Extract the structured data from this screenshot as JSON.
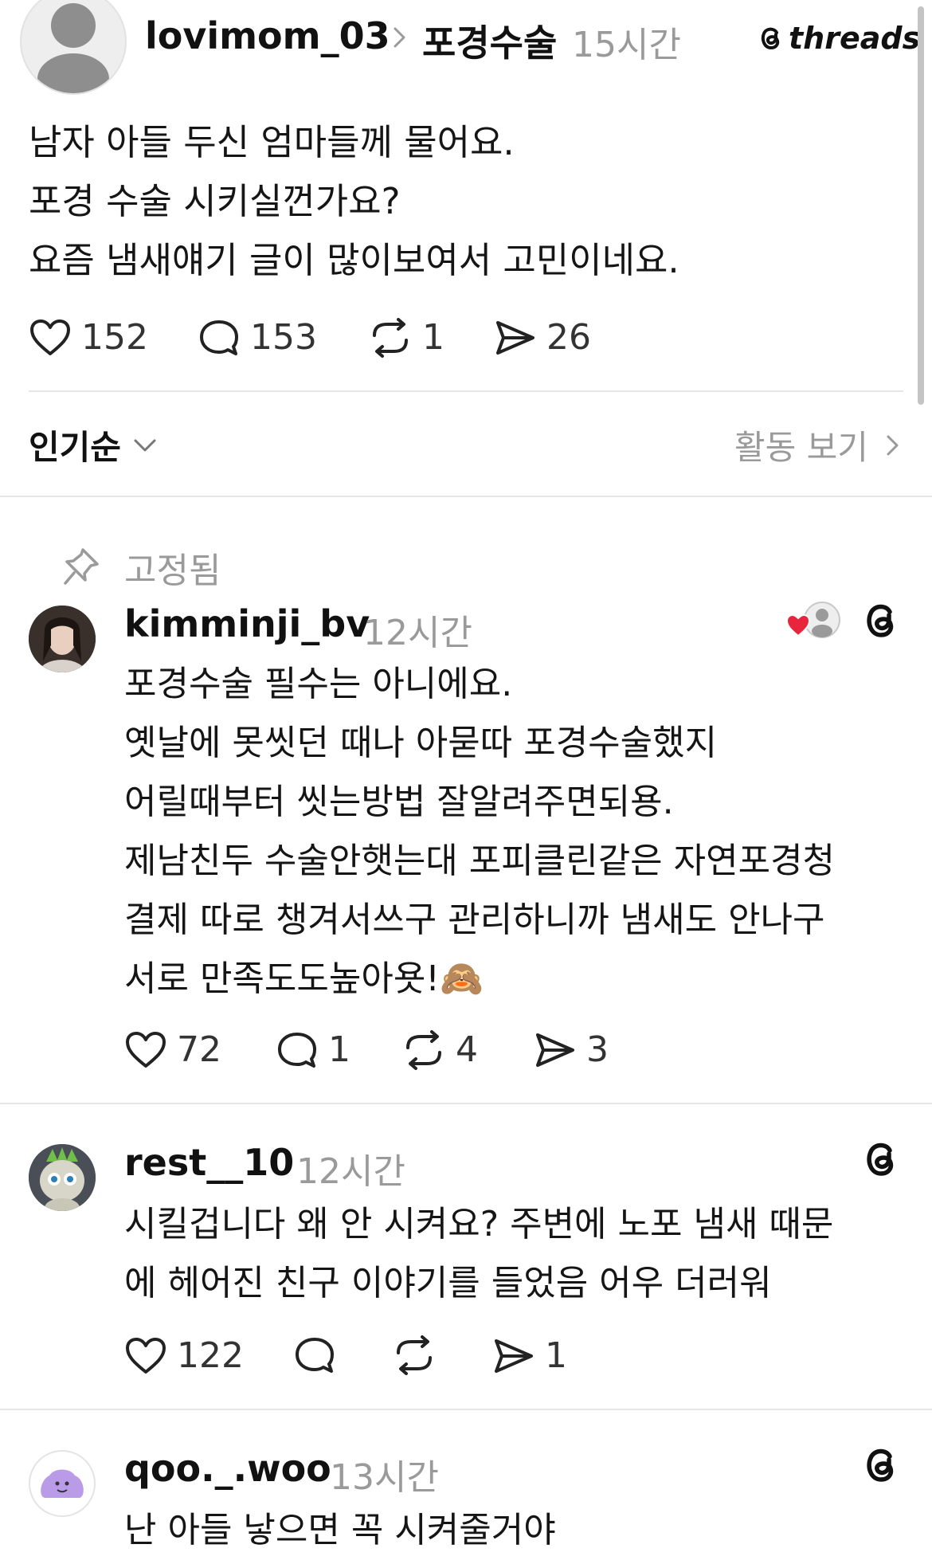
{
  "post": {
    "username": "lovimom_03",
    "topic": "포경수술",
    "time": "15시간",
    "brand": "threads",
    "text": "남자 아들 두신 엄마들께 물어요.\n포경 수술 시키실껀가요?\n요즘 냄새얘기 글이 많이보여서 고민이네요.",
    "stats": {
      "likes": "152",
      "comments": "153",
      "reposts": "1",
      "shares": "26"
    }
  },
  "sort": {
    "label": "인기순",
    "activity_label": "활동 보기"
  },
  "pinned_label": "고정됨",
  "comments": [
    {
      "username": "kimminji_bv",
      "time": "12시간",
      "text": "포경수술 필수는 아니에요.\n옛날에 못씻던 때나 아묻따 포경수술했지\n어릴때부터 씻는방법 잘알려주면되용.\n제남친두 수술안햇는대 포피클린같은 자연포경청\n결제 따로 챙겨서쓰구 관리하니까 냄새도 안나구\n서로 만족도도높아욧!🙈",
      "stats": {
        "likes": "72",
        "comments": "1",
        "reposts": "4",
        "shares": "3"
      }
    },
    {
      "username": "rest__10",
      "time": "12시간",
      "text": "시킬겁니다 왜 안 시켜요? 주변에 노포 냄새 때문\n에 헤어진 친구 이야기를 들었음 어우 더러워",
      "stats": {
        "likes": "122",
        "comments": "",
        "reposts": "",
        "shares": "1"
      }
    },
    {
      "username": "qoo._.woo",
      "time": "13시간",
      "text": "난 아들 낳으면 꼭 시켜줄거야"
    }
  ],
  "colors": {
    "accent_heart": "#e8253d",
    "muted": "#9a9a9a",
    "divider": "#e6e6e6"
  }
}
